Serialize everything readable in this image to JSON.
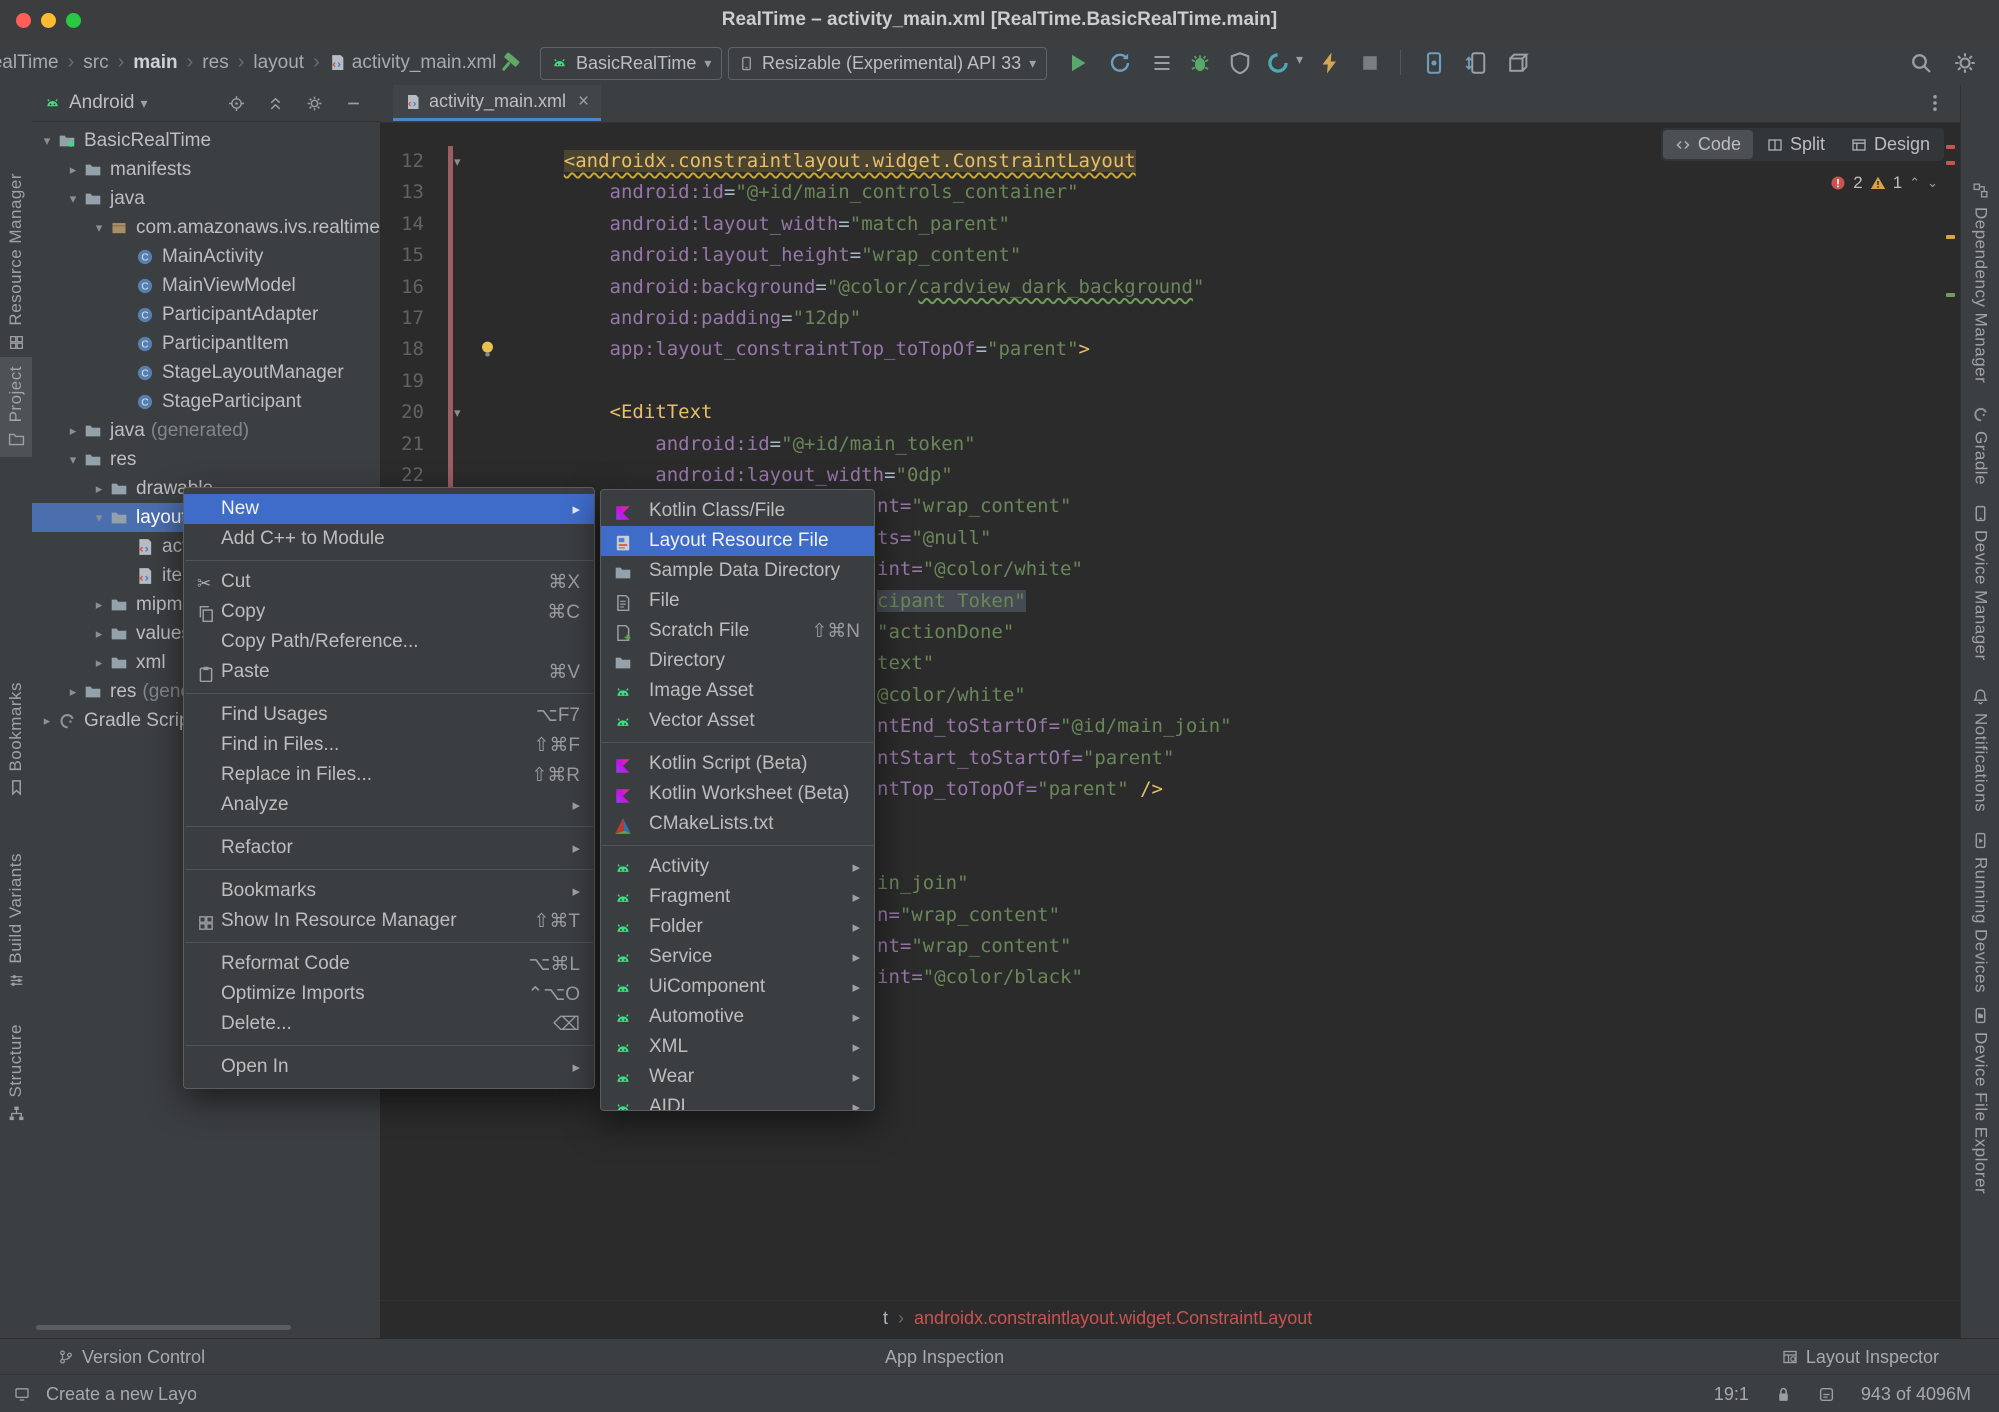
{
  "window": {
    "title": "RealTime – activity_main.xml [RealTime.BasicRealTime.main]"
  },
  "colors": {
    "selection_blue": "#3F6CC9",
    "tree_selection_blue": "#4B6EAF",
    "android_green": "#3DDC84",
    "run_green": "#59A869",
    "error_red": "#C75450",
    "warning_yellow": "#D9A343",
    "tab_underline": "#4A88C7"
  },
  "toolbar": {
    "breadcrumbs": [
      {
        "label": "RealTime",
        "cut": true
      },
      {
        "label": "src"
      },
      {
        "label": "main",
        "bold": true
      },
      {
        "label": "res"
      },
      {
        "label": "layout"
      },
      {
        "label": "activity_main.xml",
        "icon": "xml-file"
      }
    ],
    "run_config": "BasicRealTime",
    "device": "Resizable (Experimental) API 33"
  },
  "left_stripe": [
    {
      "label": "Resource Manager",
      "icon": "resource-manager"
    },
    {
      "label": "Project",
      "icon": "project-folder",
      "active": true
    },
    {
      "label": "Bookmarks",
      "icon": "bookmark"
    },
    {
      "label": "Build Variants",
      "icon": "build-variants"
    },
    {
      "label": "Structure",
      "icon": "structure"
    }
  ],
  "right_stripe": [
    {
      "label": "Dependency Manager",
      "icon": "dependency"
    },
    {
      "label": "Gradle",
      "icon": "gradle"
    },
    {
      "label": "Device Manager",
      "icon": "phone"
    },
    {
      "label": "Notifications",
      "icon": "bell"
    },
    {
      "label": "Running Devices",
      "icon": "running-devices"
    },
    {
      "label": "Device File Explorer",
      "icon": "device-explorer"
    }
  ],
  "project": {
    "mode": "Android",
    "tree": [
      {
        "d": 0,
        "ch": "v",
        "icon": "module",
        "label": "BasicRealTime"
      },
      {
        "d": 1,
        "ch": ">",
        "icon": "folder",
        "label": "manifests"
      },
      {
        "d": 1,
        "ch": "v",
        "icon": "folder",
        "label": "java"
      },
      {
        "d": 2,
        "ch": "v",
        "icon": "package",
        "label": "com.amazonaws.ivs.realtime"
      },
      {
        "d": 3,
        "ch": "",
        "icon": "class",
        "label": "MainActivity"
      },
      {
        "d": 3,
        "ch": "",
        "icon": "class",
        "label": "MainViewModel"
      },
      {
        "d": 3,
        "ch": "",
        "icon": "class",
        "label": "ParticipantAdapter"
      },
      {
        "d": 3,
        "ch": "",
        "icon": "class",
        "label": "ParticipantItem"
      },
      {
        "d": 3,
        "ch": "",
        "icon": "class",
        "label": "StageLayoutManager"
      },
      {
        "d": 3,
        "ch": "",
        "icon": "class",
        "label": "StageParticipant"
      },
      {
        "d": 1,
        "ch": ">",
        "icon": "folder",
        "label": "java",
        "suffix": "(generated)"
      },
      {
        "d": 1,
        "ch": "v",
        "icon": "folder",
        "label": "res"
      },
      {
        "d": 2,
        "ch": ">",
        "icon": "folder",
        "label": "drawable"
      },
      {
        "d": 2,
        "ch": "v",
        "icon": "folder",
        "label": "layout",
        "selected": true
      },
      {
        "d": 3,
        "ch": "",
        "icon": "xml-file",
        "label": "activity_main.xml"
      },
      {
        "d": 3,
        "ch": "",
        "icon": "xml-file",
        "label": "item_participant.xml"
      },
      {
        "d": 2,
        "ch": ">",
        "icon": "folder",
        "label": "mipmap"
      },
      {
        "d": 2,
        "ch": ">",
        "icon": "folder",
        "label": "values"
      },
      {
        "d": 2,
        "ch": ">",
        "icon": "folder",
        "label": "xml"
      },
      {
        "d": 1,
        "ch": ">",
        "icon": "folder",
        "label": "res",
        "suffix": "(generated)"
      },
      {
        "d": 0,
        "ch": ">",
        "icon": "gradle",
        "label": "Gradle Scripts"
      }
    ]
  },
  "editor": {
    "tab": "activity_main.xml",
    "modes": [
      "Code",
      "Split",
      "Design"
    ],
    "active_mode": "Code",
    "errors": "2",
    "warnings": "1",
    "lines": [
      {
        "n": 12,
        "fold": true,
        "tokens": [
          [
            "    ",
            "pl"
          ],
          [
            "<androidx.constraintlayout.widget.ConstraintLayout",
            "tagerr"
          ]
        ]
      },
      {
        "n": 13,
        "tokens": [
          [
            "        ",
            "pl"
          ],
          [
            "android:id",
            "attr"
          ],
          [
            "=",
            "pl"
          ],
          [
            "\"@+id/main_controls_container\"",
            "val"
          ]
        ]
      },
      {
        "n": 14,
        "tokens": [
          [
            "        ",
            "pl"
          ],
          [
            "android:layout_width",
            "attr"
          ],
          [
            "=",
            "pl"
          ],
          [
            "\"match_parent\"",
            "val"
          ]
        ]
      },
      {
        "n": 15,
        "tokens": [
          [
            "        ",
            "pl"
          ],
          [
            "android:layout_height",
            "attr"
          ],
          [
            "=",
            "pl"
          ],
          [
            "\"wrap_content\"",
            "val"
          ]
        ]
      },
      {
        "n": 16,
        "tokens": [
          [
            "        ",
            "pl"
          ],
          [
            "android:background",
            "attr"
          ],
          [
            "=",
            "pl"
          ],
          [
            "\"@color/",
            "val"
          ],
          [
            "cardview_dark_background",
            "typo"
          ],
          [
            "\"",
            "val"
          ]
        ]
      },
      {
        "n": 17,
        "tokens": [
          [
            "        ",
            "pl"
          ],
          [
            "android:padding",
            "attr"
          ],
          [
            "=",
            "pl"
          ],
          [
            "\"12dp\"",
            "val"
          ]
        ]
      },
      {
        "n": 18,
        "bulb": true,
        "tokens": [
          [
            "        ",
            "pl"
          ],
          [
            "app:layout_constraintTop_toTopOf",
            "attr"
          ],
          [
            "=",
            "pl"
          ],
          [
            "\"parent\"",
            "val"
          ],
          [
            ">",
            "tag"
          ]
        ]
      },
      {
        "n": 19,
        "tokens": []
      },
      {
        "n": 20,
        "fold": true,
        "tokens": [
          [
            "        ",
            "pl"
          ],
          [
            "<EditText",
            "tag"
          ]
        ]
      },
      {
        "n": 21,
        "tokens": [
          [
            "            ",
            "pl"
          ],
          [
            "android:id",
            "attr"
          ],
          [
            "=",
            "pl"
          ],
          [
            "\"@+id/main_token\"",
            "val"
          ]
        ]
      },
      {
        "n": 22,
        "tokens": [
          [
            "            ",
            "pl"
          ],
          [
            "android:layout_width",
            "attr"
          ],
          [
            "=",
            "pl"
          ],
          [
            "\"0dp\"",
            "val"
          ]
        ]
      }
    ],
    "fragments": [
      {
        "line": 23,
        "tokens": [
          [
            "nt=",
            "attr"
          ],
          [
            "\"wrap_content\"",
            "val"
          ]
        ]
      },
      {
        "line": 24,
        "tokens": [
          [
            "ts=",
            "attr"
          ],
          [
            "\"@null\"",
            "val"
          ]
        ]
      },
      {
        "line": 25,
        "tokens": [
          [
            "int=",
            "attr"
          ],
          [
            "\"@color/white\"",
            "val"
          ]
        ]
      },
      {
        "line": 26,
        "tokens": [
          [
            "cipant Token\"",
            "valhl"
          ]
        ]
      },
      {
        "line": 27,
        "tokens": [
          [
            "\"actionDone\"",
            "val"
          ]
        ]
      },
      {
        "line": 28,
        "tokens": [
          [
            "text\"",
            "val"
          ]
        ]
      },
      {
        "line": 29,
        "tokens": [
          [
            "@color/white\"",
            "val"
          ]
        ]
      },
      {
        "line": 30,
        "tokens": [
          [
            "ntEnd_toStartOf=",
            "attr"
          ],
          [
            "\"@id/main_join\"",
            "val"
          ]
        ]
      },
      {
        "line": 31,
        "tokens": [
          [
            "ntStart_toStartOf=",
            "attr"
          ],
          [
            "\"parent\"",
            "val"
          ]
        ]
      },
      {
        "line": 32,
        "tokens": [
          [
            "ntTop_toTopOf=",
            "attr"
          ],
          [
            "\"parent\"",
            "val"
          ],
          [
            " />",
            "tag"
          ]
        ]
      },
      {
        "line": 35,
        "tokens": [
          [
            "in_join\"",
            "val"
          ]
        ]
      },
      {
        "line": 36,
        "tokens": [
          [
            "n=",
            "attr"
          ],
          [
            "\"wrap_content\"",
            "val"
          ]
        ]
      },
      {
        "line": 37,
        "tokens": [
          [
            "nt=",
            "attr"
          ],
          [
            "\"wrap_content\"",
            "val"
          ]
        ]
      },
      {
        "line": 38,
        "tokens": [
          [
            "int=",
            "attr"
          ],
          [
            "\"@color/black\"",
            "val"
          ]
        ]
      }
    ],
    "breadcrumb": {
      "tail": "t",
      "element": "androidx.constraintlayout.widget.ConstraintLayout"
    }
  },
  "context_menu": {
    "items": [
      {
        "label": "New",
        "submenu": true,
        "selected": true
      },
      {
        "label": "Add C++ to Module"
      },
      {
        "separator": true
      },
      {
        "label": "Cut",
        "icon": "scissors",
        "shortcut": "⌘X"
      },
      {
        "label": "Copy",
        "icon": "copy",
        "shortcut": "⌘C"
      },
      {
        "label": "Copy Path/Reference..."
      },
      {
        "label": "Paste",
        "icon": "paste",
        "shortcut": "⌘V"
      },
      {
        "separator": true
      },
      {
        "label": "Find Usages",
        "shortcut": "⌥F7"
      },
      {
        "label": "Find in Files...",
        "shortcut": "⇧⌘F"
      },
      {
        "label": "Replace in Files...",
        "shortcut": "⇧⌘R"
      },
      {
        "label": "Analyze",
        "submenu": true
      },
      {
        "separator": true
      },
      {
        "label": "Refactor",
        "submenu": true
      },
      {
        "separator": true
      },
      {
        "label": "Bookmarks",
        "submenu": true
      },
      {
        "label": "Show In Resource Manager",
        "icon": "resource-manager",
        "shortcut": "⇧⌘T"
      },
      {
        "separator": true
      },
      {
        "label": "Reformat Code",
        "shortcut": "⌥⌘L"
      },
      {
        "label": "Optimize Imports",
        "shortcut": "⌃⌥O"
      },
      {
        "label": "Delete...",
        "shortcut": "⌫"
      },
      {
        "separator": true
      },
      {
        "label": "Open In",
        "submenu": true
      }
    ]
  },
  "new_submenu": {
    "items": [
      {
        "label": "Kotlin Class/File",
        "icon": "kotlin"
      },
      {
        "label": "Layout Resource File",
        "icon": "layout-file",
        "selected": true
      },
      {
        "label": "Sample Data Directory",
        "icon": "folder"
      },
      {
        "label": "File",
        "icon": "file"
      },
      {
        "label": "Scratch File",
        "icon": "scratch",
        "shortcut": "⇧⌘N"
      },
      {
        "label": "Directory",
        "icon": "folder"
      },
      {
        "label": "Image Asset",
        "icon": "android-head"
      },
      {
        "label": "Vector Asset",
        "icon": "android-head"
      },
      {
        "separator": true
      },
      {
        "label": "Kotlin Script (Beta)",
        "icon": "kotlin"
      },
      {
        "label": "Kotlin Worksheet (Beta)",
        "icon": "kotlin"
      },
      {
        "label": "CMakeLists.txt",
        "icon": "cmake"
      },
      {
        "separator": true
      },
      {
        "label": "Activity",
        "icon": "android-head",
        "submenu": true
      },
      {
        "label": "Fragment",
        "icon": "android-head",
        "submenu": true
      },
      {
        "label": "Folder",
        "icon": "android-head",
        "submenu": true
      },
      {
        "label": "Service",
        "icon": "android-head",
        "submenu": true
      },
      {
        "label": "UiComponent",
        "icon": "android-head",
        "submenu": true
      },
      {
        "label": "Automotive",
        "icon": "android-head",
        "submenu": true
      },
      {
        "label": "XML",
        "icon": "android-head",
        "submenu": true
      },
      {
        "label": "Wear",
        "icon": "android-head",
        "submenu": true
      },
      {
        "label": "AIDL",
        "icon": "android-head",
        "submenu": true
      }
    ]
  },
  "windows_bar": {
    "version_control": "Version Control",
    "app_inspection": "App Inspection",
    "layout_inspector": "Layout Inspector"
  },
  "status_bar": {
    "message": "Create a new Layout Resource File",
    "caret": "19:1",
    "memory": "943 of 4096M"
  }
}
